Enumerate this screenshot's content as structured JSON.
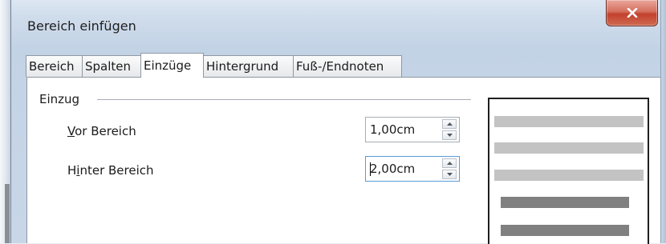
{
  "window": {
    "title": "Bereich einfügen"
  },
  "tabs": [
    {
      "label": "Bereich"
    },
    {
      "label": "Spalten"
    },
    {
      "label": "Einzüge",
      "active": true
    },
    {
      "label": "Hintergrund"
    },
    {
      "label": "Fuß-/Endnoten"
    }
  ],
  "indent": {
    "group_label": "Einzug",
    "before": {
      "label_mnemonic": "V",
      "label_rest": "or Bereich",
      "value": "1,00cm"
    },
    "after": {
      "label_pre": "H",
      "label_mnemonic": "i",
      "label_rest": "nter Bereich",
      "value": "2,00cm"
    }
  },
  "colors": {
    "close_button": "#c2412d",
    "preview_light_line": "#c3c3c3",
    "preview_dark_line": "#808080"
  },
  "icons": {
    "close": "close-icon",
    "spin_up": "spin-up-icon",
    "spin_down": "spin-down-icon"
  }
}
